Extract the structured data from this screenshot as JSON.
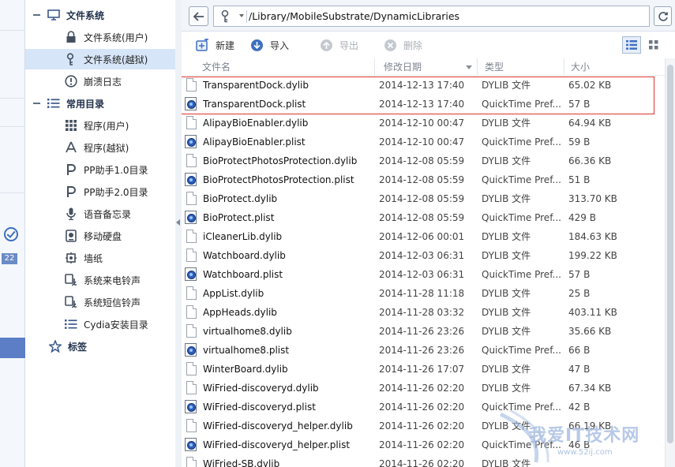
{
  "tree": {
    "items": [
      {
        "label": "文件系统",
        "kind": "group",
        "icon": "monitor-icon"
      },
      {
        "label": "文件系统(用户)",
        "kind": "child",
        "icon": "lock-icon"
      },
      {
        "label": "文件系统(越狱)",
        "kind": "child",
        "icon": "key-icon",
        "selected": true
      },
      {
        "label": "崩溃日志",
        "kind": "child",
        "icon": "alert-icon"
      },
      {
        "label": "常用目录",
        "kind": "group",
        "icon": "list-icon"
      },
      {
        "label": "程序(用户)",
        "kind": "child",
        "icon": "grid-icon"
      },
      {
        "label": "程序(越狱)",
        "kind": "child",
        "icon": "appstore-icon"
      },
      {
        "label": "PP助手1.0目录",
        "kind": "child",
        "icon": "pp-icon"
      },
      {
        "label": "PP助手2.0目录",
        "kind": "child",
        "icon": "pp-icon"
      },
      {
        "label": "语音备忘录",
        "kind": "child",
        "icon": "microphone-icon"
      },
      {
        "label": "移动硬盘",
        "kind": "child",
        "icon": "hard-disk-icon"
      },
      {
        "label": "墙纸",
        "kind": "child",
        "icon": "wallpaper-icon"
      },
      {
        "label": "系统来电铃声",
        "kind": "child",
        "icon": "ringtone-icon"
      },
      {
        "label": "系统短信铃声",
        "kind": "child",
        "icon": "ringtone-icon"
      },
      {
        "label": "Cydia安装目录",
        "kind": "child",
        "icon": "list-icon"
      },
      {
        "label": "标签",
        "kind": "group-noexp",
        "icon": "star-icon"
      }
    ]
  },
  "leftstrip": {
    "badge": "22"
  },
  "address": {
    "path": "/Library/MobileSubstrate/DynamicLibraries"
  },
  "toolbar": {
    "new_label": "新建",
    "import_label": "导入",
    "export_label": "导出",
    "delete_label": "删除"
  },
  "columns": {
    "name": "文件名",
    "date": "修改日期",
    "type": "类型",
    "size": "大小"
  },
  "files": [
    {
      "name": "TransparentDock.dylib",
      "date": "2014-12-13 17:40",
      "type": "DYLIB 文件",
      "size": "65.02 KB",
      "icon": "doc"
    },
    {
      "name": "TransparentDock.plist",
      "date": "2014-12-13 17:40",
      "type": "QuickTime Pref...",
      "size": "57 B",
      "icon": "plist"
    },
    {
      "name": "AlipayBioEnabler.dylib",
      "date": "2014-12-10 00:47",
      "type": "DYLIB 文件",
      "size": "64.94 KB",
      "icon": "doc"
    },
    {
      "name": "AlipayBioEnabler.plist",
      "date": "2014-12-10 00:47",
      "type": "QuickTime Pref...",
      "size": "59 B",
      "icon": "plist"
    },
    {
      "name": "BioProtectPhotosProtection.dylib",
      "date": "2014-12-08 05:59",
      "type": "DYLIB 文件",
      "size": "66.36 KB",
      "icon": "doc"
    },
    {
      "name": "BioProtectPhotosProtection.plist",
      "date": "2014-12-08 05:59",
      "type": "QuickTime Pref...",
      "size": "51 B",
      "icon": "plist"
    },
    {
      "name": "BioProtect.dylib",
      "date": "2014-12-08 05:59",
      "type": "DYLIB 文件",
      "size": "313.70 KB",
      "icon": "doc"
    },
    {
      "name": "BioProtect.plist",
      "date": "2014-12-08 05:59",
      "type": "QuickTime Pref...",
      "size": "429 B",
      "icon": "plist"
    },
    {
      "name": "iCleanerLib.dylib",
      "date": "2014-12-06 00:01",
      "type": "DYLIB 文件",
      "size": "184.63 KB",
      "icon": "doc"
    },
    {
      "name": "Watchboard.dylib",
      "date": "2014-12-03 06:31",
      "type": "DYLIB 文件",
      "size": "199.22 KB",
      "icon": "doc"
    },
    {
      "name": "Watchboard.plist",
      "date": "2014-12-03 06:31",
      "type": "QuickTime Pref...",
      "size": "57 B",
      "icon": "plist"
    },
    {
      "name": "AppList.dylib",
      "date": "2014-11-28 11:18",
      "type": "DYLIB 文件",
      "size": "25 B",
      "icon": "doc"
    },
    {
      "name": "AppHeads.dylib",
      "date": "2014-11-28 03:32",
      "type": "DYLIB 文件",
      "size": "403.11 KB",
      "icon": "doc"
    },
    {
      "name": "virtualhome8.dylib",
      "date": "2014-11-26 23:26",
      "type": "DYLIB 文件",
      "size": "35.66 KB",
      "icon": "doc"
    },
    {
      "name": "virtualhome8.plist",
      "date": "2014-11-26 23:26",
      "type": "QuickTime Pref...",
      "size": "66 B",
      "icon": "plist"
    },
    {
      "name": "WinterBoard.dylib",
      "date": "2014-11-26 17:07",
      "type": "DYLIB 文件",
      "size": "47 B",
      "icon": "doc"
    },
    {
      "name": "WiFried-discoveryd.dylib",
      "date": "2014-11-26 02:20",
      "type": "DYLIB 文件",
      "size": "67.34 KB",
      "icon": "doc"
    },
    {
      "name": "WiFried-discoveryd.plist",
      "date": "2014-11-26 02:20",
      "type": "QuickTime Pref...",
      "size": "42 B",
      "icon": "plist"
    },
    {
      "name": "WiFried-discoveryd_helper.dylib",
      "date": "2014-11-26 02:20",
      "type": "DYLIB 文件",
      "size": "66.19 KB",
      "icon": "doc"
    },
    {
      "name": "WiFried-discoveryd_helper.plist",
      "date": "2014-11-26 02:20",
      "type": "QuickTime Pref...",
      "size": "46 B",
      "icon": "plist"
    },
    {
      "name": "WiFried-SB.dylib",
      "date": "2014-11-26 02:20",
      "type": "DYLIB 文件",
      "size": "",
      "icon": "doc"
    }
  ],
  "watermark": {
    "title": "我爱IT技术网",
    "url": "www.52ij.com"
  },
  "colors": {
    "accent": "#3d6fc0",
    "selection": "#d6e5f8",
    "highlight_border": "#e0332d"
  }
}
